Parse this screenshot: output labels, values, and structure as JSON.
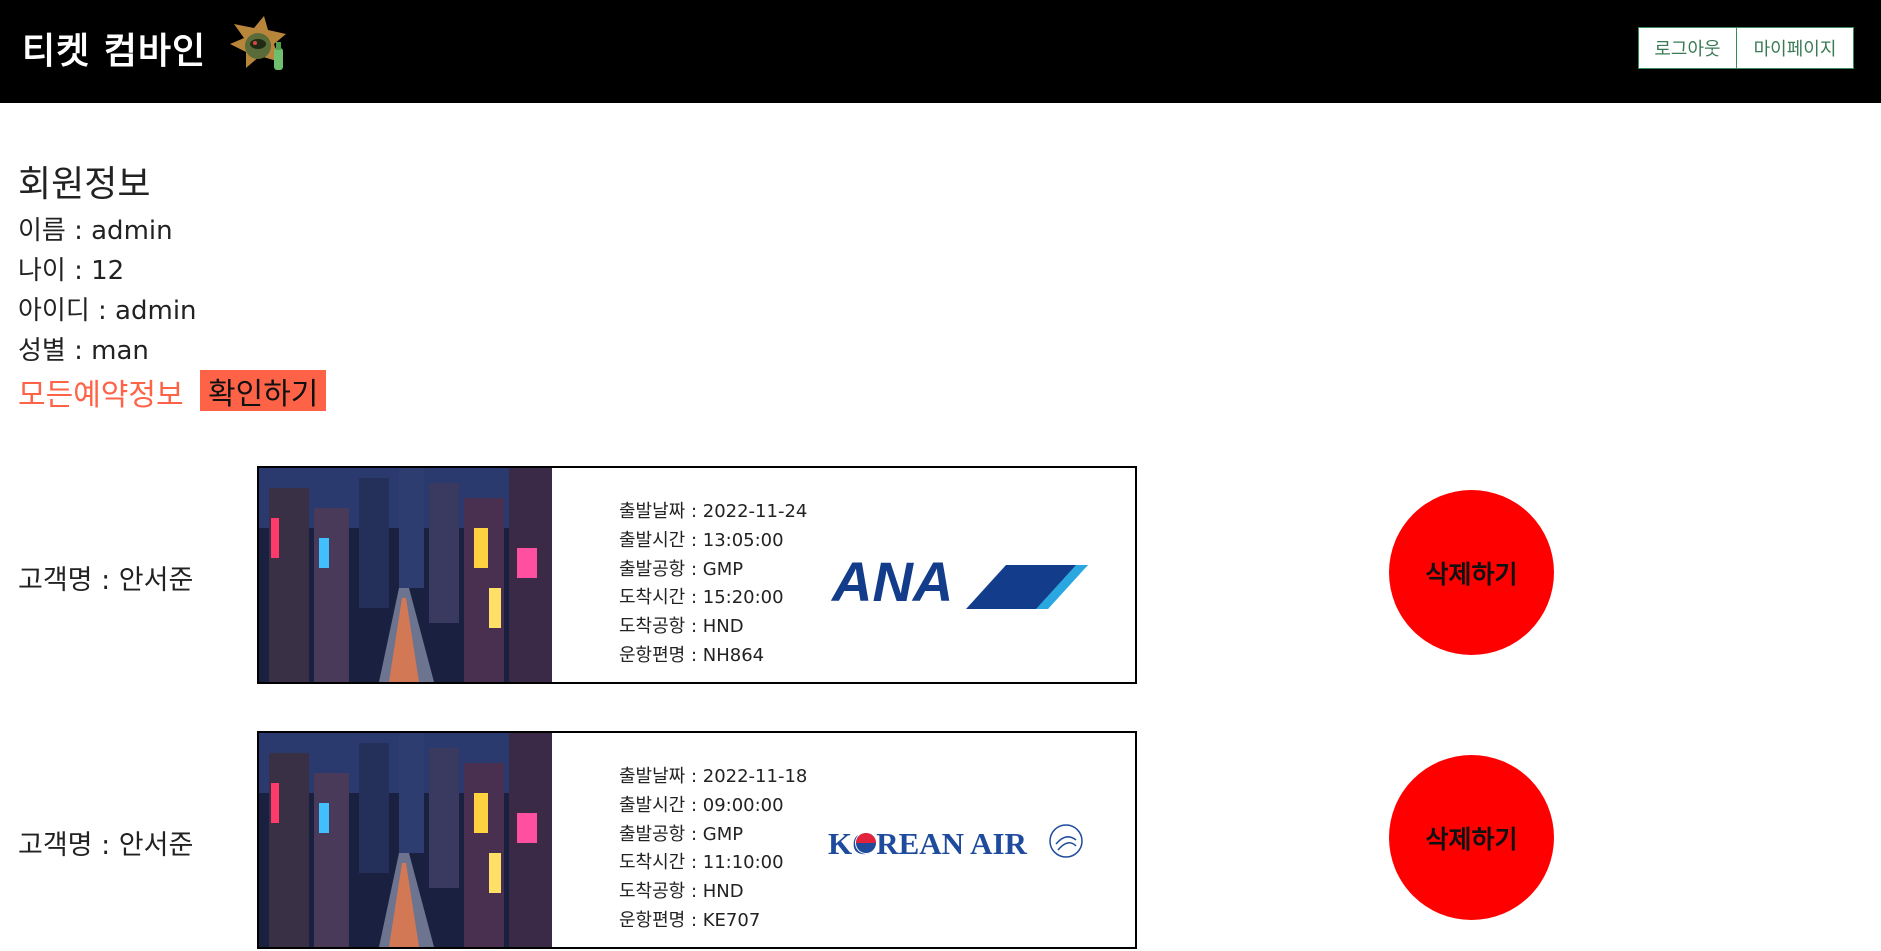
{
  "header": {
    "brand": "티켓 컴바인",
    "logout_label": "로그아웃",
    "mypage_label": "마이페이지"
  },
  "member": {
    "title": "회원정보",
    "name_line": "이름 : admin",
    "age_line": "나이 : 12",
    "id_line": "아이디 : admin",
    "gender_line": "성별 : man",
    "all_reservations_label": "모든예약정보",
    "confirm_label": "확인하기"
  },
  "reservations": [
    {
      "customer": "고객명 : 안서준",
      "departure_date": "출발날짜 : 2022-11-24",
      "departure_time": "출발시간 : 13:05:00",
      "departure_airport": "출발공항 : GMP",
      "arrival_time": "도착시간 : 15:20:00",
      "arrival_airport": "도착공항 : HND",
      "flight": "운항편명 : NH864",
      "airline_logo_text": "ANA",
      "delete_label": "삭제하기"
    },
    {
      "customer": "고객명 : 안서준",
      "departure_date": "출발날짜 : 2022-11-18",
      "departure_time": "출발시간 : 09:00:00",
      "departure_airport": "출발공항 : GMP",
      "arrival_time": "도착시간 : 11:10:00",
      "arrival_airport": "도착공항 : HND",
      "flight": "운항편명 : KE707",
      "airline_logo_text": "KOREAN AIR",
      "delete_label": "삭제하기"
    }
  ],
  "colors": {
    "header_bg": "#000000",
    "accent": "#ff6347",
    "delete": "#ff0000",
    "nav_border": "#3a8a5c",
    "ana_blue": "#133c8b",
    "korean_air_blue": "#1f4b9c"
  }
}
